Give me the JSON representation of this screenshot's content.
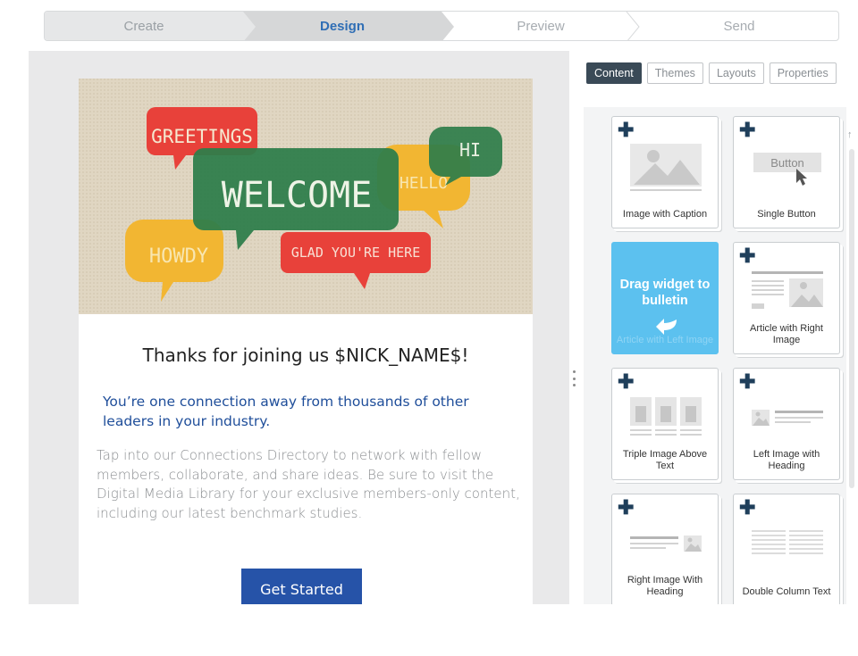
{
  "steps": [
    "Create",
    "Design",
    "Preview",
    "Send"
  ],
  "active_step": "Design",
  "email": {
    "hero_text": {
      "greetings": "GREETINGS",
      "welcome": "WELCOME",
      "hi": "HI",
      "hello": "HELLO",
      "howdy": "HOWDY",
      "glad": "GLAD YOU'RE HERE"
    },
    "title": "Thanks for joining us $NICK_NAME$!",
    "subtitle": "You’re one connection away from thousands of other leaders in your industry.",
    "body": "Tap into our Connections Directory to network with fellow members, collaborate, and share ideas. Be sure to visit the Digital Media Library for your exclusive members-only content, including our latest benchmark studies.",
    "cta": "Get Started"
  },
  "panel_tabs": [
    "Content",
    "Themes",
    "Layouts",
    "Properties"
  ],
  "active_tab": "Content",
  "widgets": [
    {
      "label": "Image with Caption",
      "icon": "image-caption-icon"
    },
    {
      "label": "Single Button",
      "icon": "button-icon",
      "button_text": "Button"
    },
    {
      "label": "Article with Left Image",
      "icon": "drag-icon",
      "drag_msg": "Drag widget to bulletin"
    },
    {
      "label": "Article with Right Image",
      "icon": "article-right-image-icon"
    },
    {
      "label": "Triple Image Above Text",
      "icon": "triple-image-icon"
    },
    {
      "label": "Left Image with Heading",
      "icon": "left-image-heading-icon"
    },
    {
      "label": "Right Image With Heading",
      "icon": "right-image-heading-icon"
    },
    {
      "label": "Double Column Text",
      "icon": "double-column-text-icon"
    }
  ],
  "colors": {
    "accent": "#2f6eb5",
    "cta": "#2653a8",
    "drag_card": "#5cc1ef",
    "tab_active": "#3a4a57"
  }
}
